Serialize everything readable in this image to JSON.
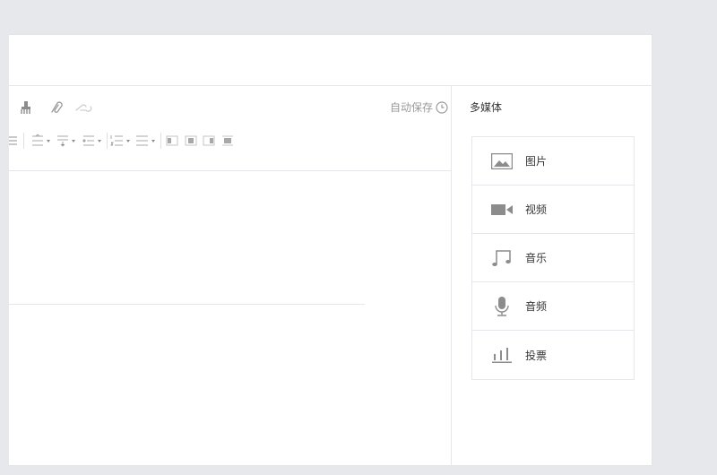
{
  "toolbar": {
    "autosave_label": "自动保存",
    "row1_icons": [
      "clear-format-icon",
      "link-icon",
      "unlink-icon"
    ],
    "row2_icons": [
      "align-justify-icon",
      "line-height-icon",
      "paragraph-spacing-icon",
      "indent-icon",
      "ordered-list-icon",
      "unordered-list-icon",
      "align-left-icon",
      "align-center-icon",
      "align-right-icon",
      "align-full-icon"
    ]
  },
  "sidebar": {
    "title": "多媒体",
    "items": [
      {
        "label": "图片",
        "icon": "image-icon"
      },
      {
        "label": "视频",
        "icon": "video-icon"
      },
      {
        "label": "音乐",
        "icon": "music-icon"
      },
      {
        "label": "音频",
        "icon": "microphone-icon"
      },
      {
        "label": "投票",
        "icon": "poll-icon"
      }
    ]
  },
  "colors": {
    "icon": "#9a9a9a",
    "border": "#e7e7eb",
    "background": "#e7e8eb"
  }
}
